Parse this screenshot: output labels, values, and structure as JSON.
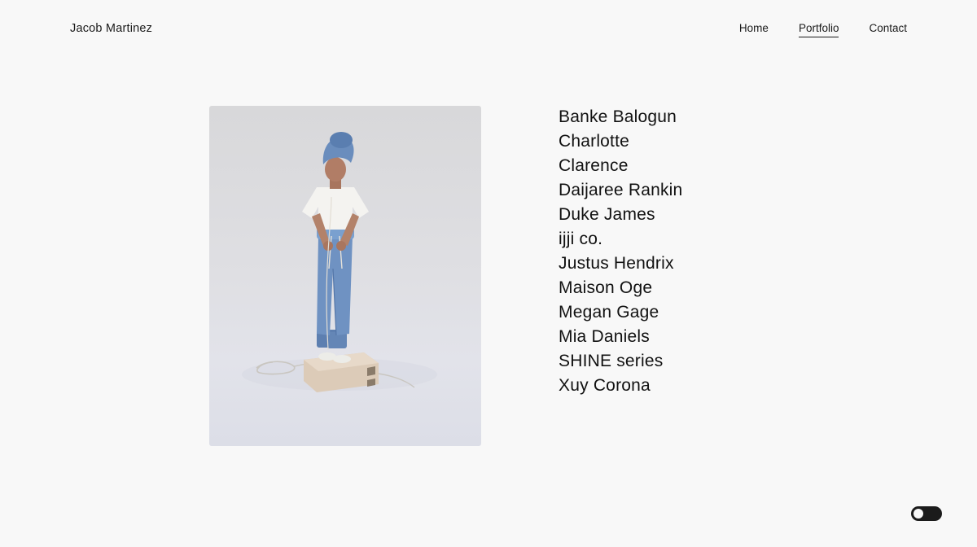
{
  "header": {
    "site_title": "Jacob Martinez",
    "nav": [
      {
        "label": "Home",
        "active": false
      },
      {
        "label": "Portfolio",
        "active": true
      },
      {
        "label": "Contact",
        "active": false
      }
    ]
  },
  "main": {
    "clients": [
      "Banke Balogun",
      "Charlotte",
      "Clarence",
      "Daijaree Rankin",
      "Duke James",
      "ijji co.",
      "Justus Hendrix",
      "Maison Oge",
      "Megan Gage",
      "Mia Daniels",
      "SHINE series",
      "Xuy Corona"
    ]
  },
  "theme_toggle": {
    "state": "off",
    "colors": {
      "track": "#1b1b1b",
      "knob": "#f8f8f8"
    }
  },
  "colors": {
    "background": "#f8f8f8",
    "text": "#1a1a1a"
  }
}
